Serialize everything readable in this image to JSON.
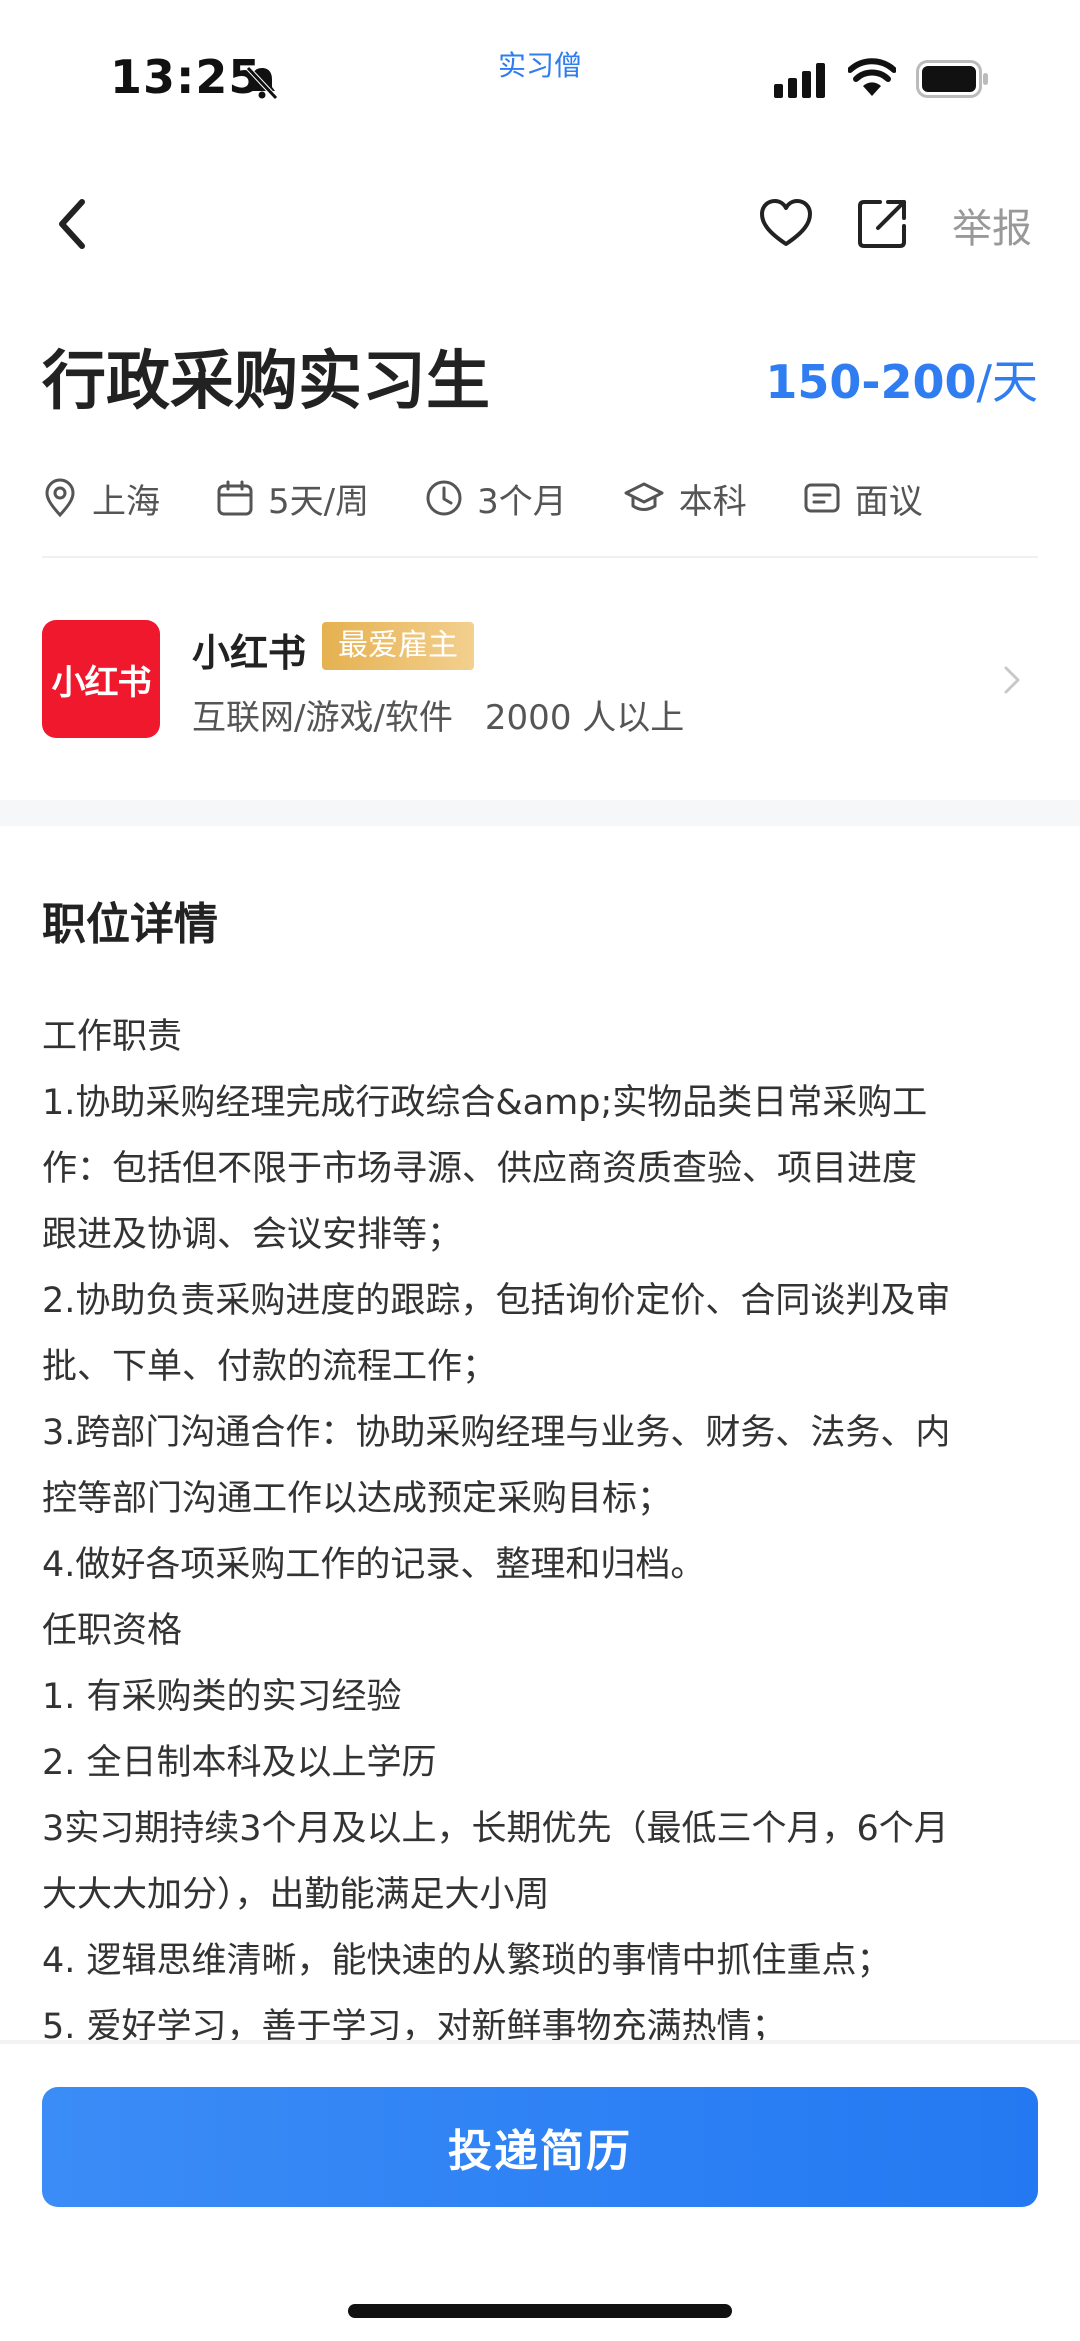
{
  "status_bar": {
    "time": "13:25",
    "center_label": "实习僧"
  },
  "nav": {
    "report_label": "举报"
  },
  "job": {
    "title": "行政采购实习生",
    "salary": "150-200",
    "salary_unit": "/天",
    "attributes": [
      {
        "icon": "location-icon",
        "label": "上海"
      },
      {
        "icon": "calendar-icon",
        "label": "5天/周"
      },
      {
        "icon": "clock-icon",
        "label": "3个月"
      },
      {
        "icon": "graduation-cap-icon",
        "label": "本科"
      },
      {
        "icon": "message-icon",
        "label": "面议"
      }
    ]
  },
  "company": {
    "logo_text": "小红书",
    "name": "小红书",
    "badge": "最爱雇主",
    "industry": "互联网/游戏/软件",
    "size": "2000 人以上"
  },
  "details": {
    "section_title": "职位详情",
    "lines": [
      "工作职责",
      "1.协助采购经理完成行政综合&amp;实物品类日常采购工",
      "作：包括但不限于市场寻源、供应商资质查验、项目进度",
      "跟进及协调、会议安排等；",
      "2.协助负责采购进度的跟踪，包括询价定价、合同谈判及审",
      "批、下单、付款的流程工作；",
      "3.跨部门沟通合作：协助采购经理与业务、财务、法务、内",
      "控等部门沟通工作以达成预定采购目标；",
      "4.做好各项采购工作的记录、整理和归档。",
      "任职资格",
      "1. 有采购类的实习经验",
      "2. 全日制本科及以上学历",
      "3实习期持续3个月及以上，长期优先（最低三个月，6个月",
      "大大大加分），出勤能满足大小周",
      "4. 逻辑思维清晰，能快速的从繁琐的事情中抓住重点；",
      "5. 爱好学习，善于学习，对新鲜事物充满热情；"
    ]
  },
  "apply_button": {
    "label": "投递简历"
  },
  "colors": {
    "accent": "#2f7df0",
    "logo_red": "#f0182c",
    "badge_gold": "#e5b150"
  }
}
